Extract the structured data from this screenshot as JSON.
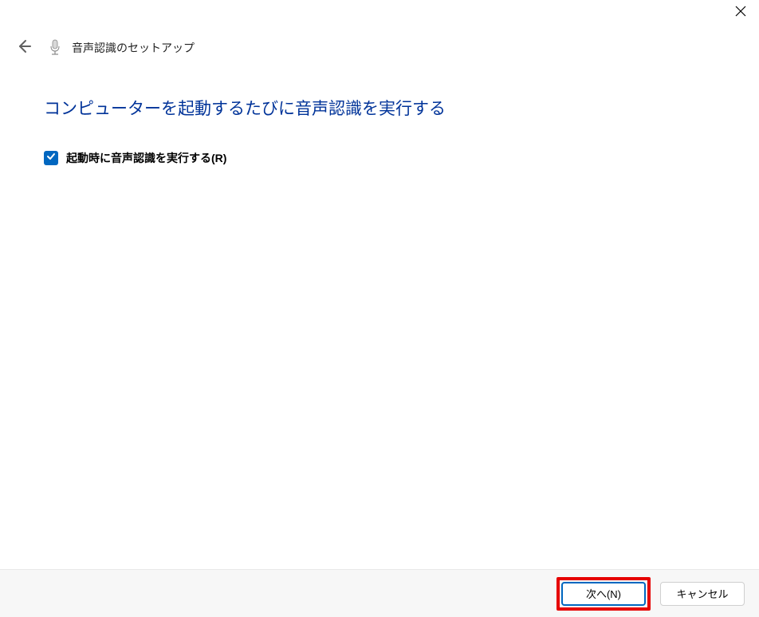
{
  "titlebar": {
    "close_label": "Close"
  },
  "header": {
    "back_label": "Back",
    "title": "音声認識のセットアップ"
  },
  "main": {
    "heading": "コンピューターを起動するたびに音声認識を実行する",
    "checkbox": {
      "checked": true,
      "label": "起動時に音声認識を実行する(R)"
    }
  },
  "footer": {
    "next_label": "次へ(N)",
    "cancel_label": "キャンセル"
  }
}
